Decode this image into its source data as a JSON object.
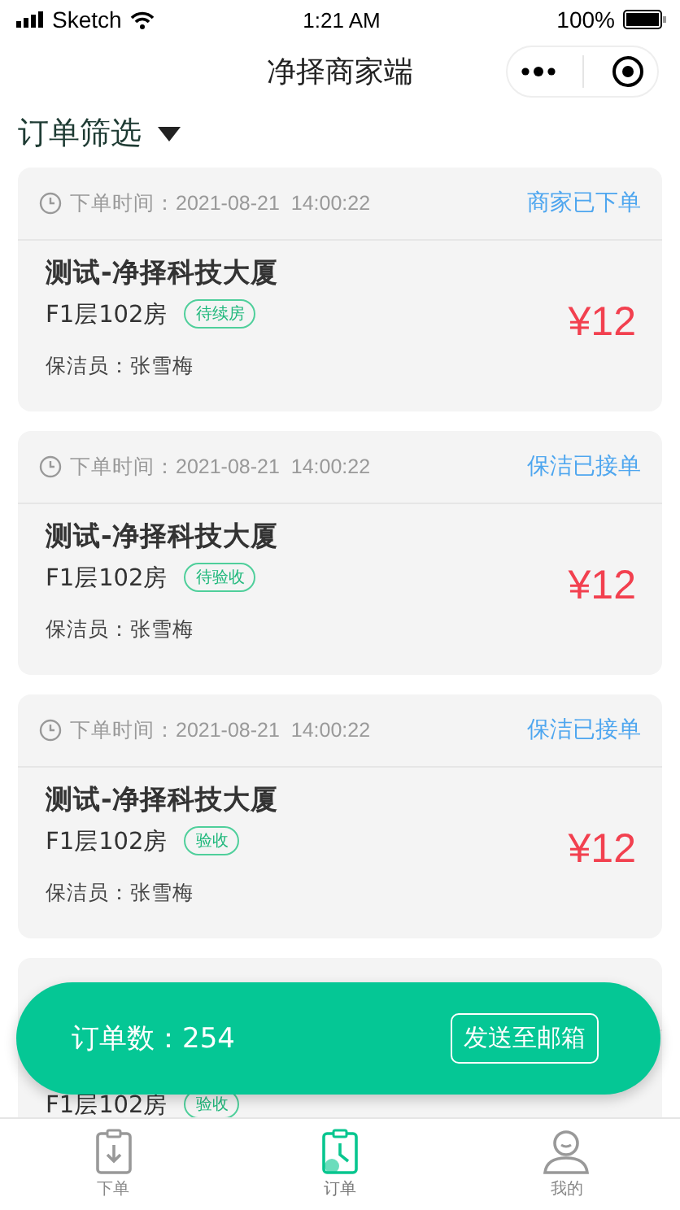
{
  "status_bar": {
    "carrier": "Sketch",
    "time": "1:21 AM",
    "battery": "100%"
  },
  "nav": {
    "title": "净择商家端"
  },
  "filter": {
    "label": "订单筛选"
  },
  "orders": [
    {
      "time": "下单时间：2021-08-21  14:00:22",
      "status": "商家已下单",
      "title": "测试-净择科技大厦",
      "room": "F1层102房",
      "tag": "待续房",
      "cleaner": "保洁员：张雪梅",
      "price": "¥12"
    },
    {
      "time": "下单时间：2021-08-21  14:00:22",
      "status": "保洁已接单",
      "title": "测试-净择科技大厦",
      "room": "F1层102房",
      "tag": "待验收",
      "cleaner": "保洁员：张雪梅",
      "price": "¥12"
    },
    {
      "time": "下单时间：2021-08-21  14:00:22",
      "status": "保洁已接单",
      "title": "测试-净择科技大厦",
      "room": "F1层102房",
      "tag": "验收",
      "cleaner": "保洁员：张雪梅",
      "price": "¥12"
    },
    {
      "room": "F1层102房",
      "tag": "验收"
    }
  ],
  "summary": {
    "label": "订单数：",
    "count": "254",
    "button": "发送至邮箱"
  },
  "tabbar": [
    {
      "label": "下单",
      "kind": "order",
      "selected": false
    },
    {
      "label": "订单",
      "kind": "list",
      "selected": true
    },
    {
      "label": "我的",
      "kind": "profile",
      "selected": false
    }
  ]
}
